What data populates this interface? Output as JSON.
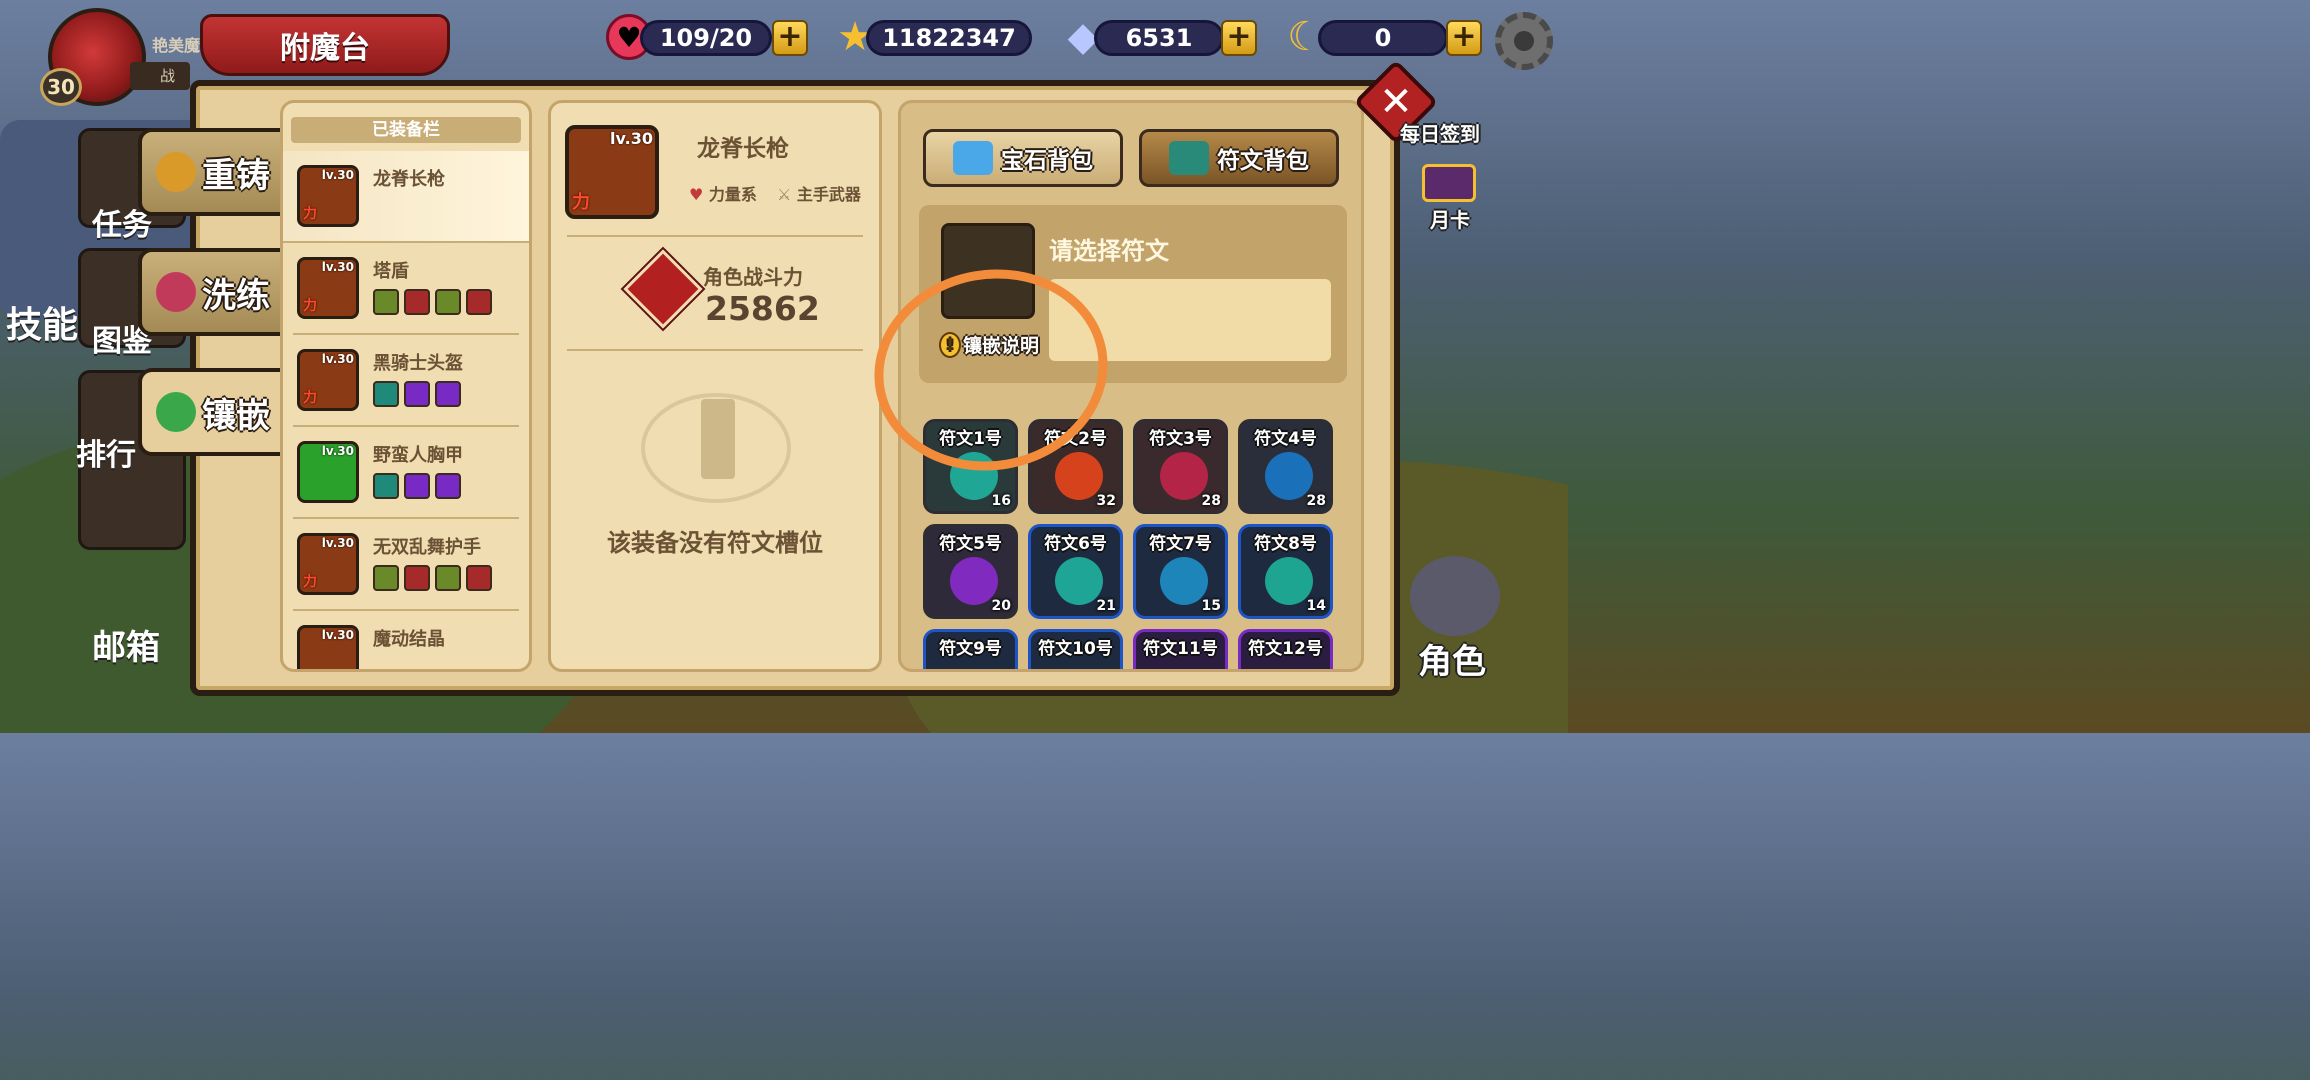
{
  "player": {
    "name": "艳美魔夜",
    "level": "30",
    "sub_label": "战"
  },
  "screen_title": "附魔台",
  "resources": [
    {
      "name": "stamina",
      "icon": "heart-icon",
      "value": "109/20",
      "color": "#e8385a"
    },
    {
      "name": "gold",
      "icon": "star-icon",
      "value": "11822347",
      "color": "#f5c030"
    },
    {
      "name": "diamond",
      "icon": "diamond-icon",
      "value": "6531",
      "color": "#9ab6ff"
    },
    {
      "name": "moon",
      "icon": "moon-icon",
      "value": "0",
      "color": "#f5c030"
    }
  ],
  "left_menu": {
    "task": "任务",
    "skill": "技能",
    "codex": "图鉴",
    "rank": "排行",
    "mail": "邮箱"
  },
  "tabs": [
    {
      "label": "重铸",
      "icon": "reforge-icon"
    },
    {
      "label": "洗练",
      "icon": "refine-icon"
    },
    {
      "label": "镶嵌",
      "icon": "inlay-icon"
    }
  ],
  "equipped": {
    "header": "已装备栏",
    "items": [
      {
        "name": "龙脊长枪",
        "level": "lv.30",
        "attr": "力",
        "color": "#8a3a14"
      },
      {
        "name": "塔盾",
        "level": "lv.30",
        "attr": "力",
        "color": "#8a3a14",
        "slots": [
          "#6a8a2a",
          "#a62a2a",
          "#6a8a2a",
          "#a62a2a"
        ]
      },
      {
        "name": "黑骑士头盔",
        "level": "lv.30",
        "attr": "力",
        "color": "#8a3a14",
        "slots": [
          "#1f8a7a",
          "#7a2ac4",
          "#7a2ac4"
        ]
      },
      {
        "name": "野蛮人胸甲",
        "level": "lv.30",
        "attr": "",
        "color": "#2aa12a",
        "slots": [
          "#1f8a7a",
          "#7a2ac4",
          "#7a2ac4"
        ]
      },
      {
        "name": "无双乱舞护手",
        "level": "lv.30",
        "attr": "力",
        "color": "#8a3a14",
        "slots": [
          "#6a8a2a",
          "#a62a2a",
          "#6a8a2a",
          "#a62a2a"
        ]
      },
      {
        "name": "魔动结晶",
        "level": "lv.30",
        "attr": "",
        "color": "#8a3a14"
      }
    ]
  },
  "selected_item": {
    "name": "龙脊长枪",
    "level": "lv.30",
    "attr": "力",
    "tag1": "力量系",
    "tag2": "主手武器",
    "power_label": "角色战斗力",
    "power_value": "25862",
    "no_slot_text": "该装备没有符文槽位"
  },
  "bags": {
    "gem": "宝石背包",
    "rune": "符文背包"
  },
  "rune_select": {
    "title": "请选择符文",
    "help": "镶嵌说明"
  },
  "runes": [
    {
      "label": "符文1号",
      "count": "16",
      "frame": "grey",
      "glow": "#1fb3a0"
    },
    {
      "label": "符文2号",
      "count": "32",
      "frame": "grey",
      "glow": "#e8451a"
    },
    {
      "label": "符文3号",
      "count": "28",
      "frame": "grey",
      "glow": "#c2244a"
    },
    {
      "label": "符文4号",
      "count": "28",
      "frame": "grey",
      "glow": "#1a78c9"
    },
    {
      "label": "符文5号",
      "count": "20",
      "frame": "grey",
      "glow": "#8a2acf"
    },
    {
      "label": "符文6号",
      "count": "21",
      "frame": "blue",
      "glow": "#1fb3a0"
    },
    {
      "label": "符文7号",
      "count": "15",
      "frame": "blue",
      "glow": "#1f8fc9"
    },
    {
      "label": "符文8号",
      "count": "14",
      "frame": "blue",
      "glow": "#1fb39a"
    },
    {
      "label": "符文9号",
      "count": "",
      "frame": "blue",
      "glow": "#3a5a9a"
    },
    {
      "label": "符文10号",
      "count": "",
      "frame": "blue",
      "glow": "#3a5a9a"
    },
    {
      "label": "符文11号",
      "count": "",
      "frame": "purple",
      "glow": "#7a2ac4"
    },
    {
      "label": "符文12号",
      "count": "",
      "frame": "purple",
      "glow": "#7a2ac4"
    }
  ],
  "right_menu": {
    "daily_signin": "每日签到",
    "month_card": "月卡",
    "character": "角色"
  }
}
